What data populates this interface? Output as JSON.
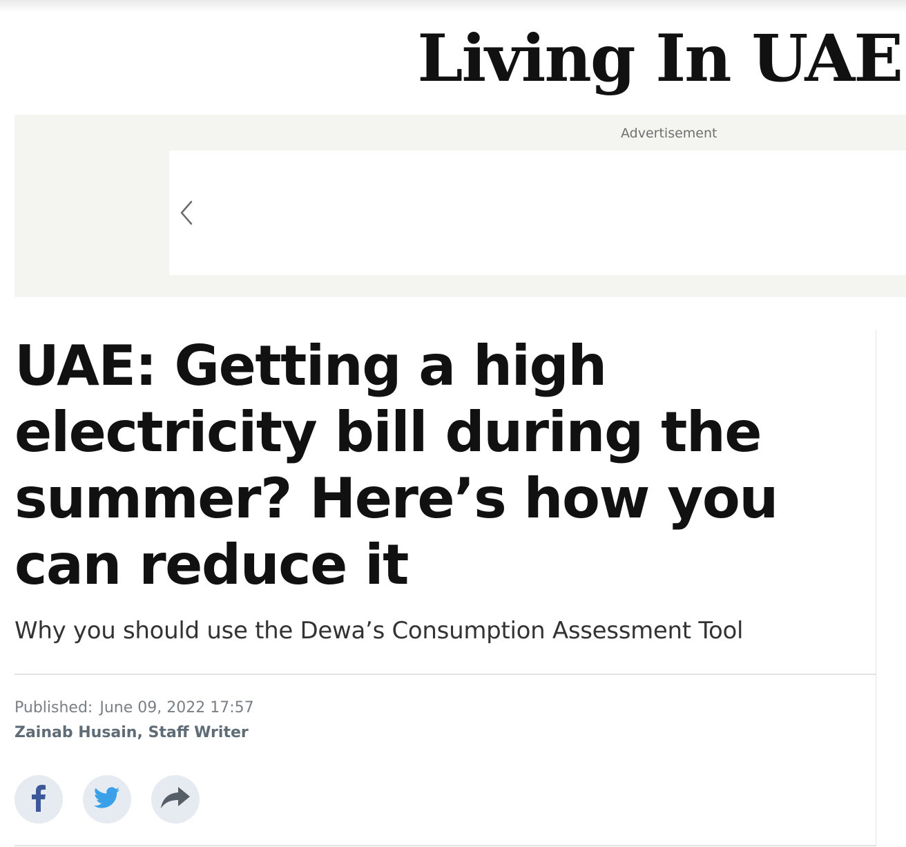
{
  "site": {
    "section_title": "Living In UAE"
  },
  "advertisement": {
    "label": "Advertisement",
    "prev_icon": "chevron-left-icon"
  },
  "article": {
    "headline": "UAE: Getting a high electricity bill during the summer? Here’s how you can reduce it",
    "subtitle": "Why you should use the Dewa’s Consumption Assessment Tool",
    "published_label": "Published:",
    "published_date": "June 09, 2022 17:57",
    "author": "Zainab Husain, Staff Writer"
  },
  "share": {
    "buttons": [
      {
        "icon": "facebook-icon",
        "color": "#3b5998"
      },
      {
        "icon": "twitter-icon",
        "color": "#3aa1e9"
      },
      {
        "icon": "share-arrow-icon",
        "color": "#555e66"
      }
    ]
  }
}
